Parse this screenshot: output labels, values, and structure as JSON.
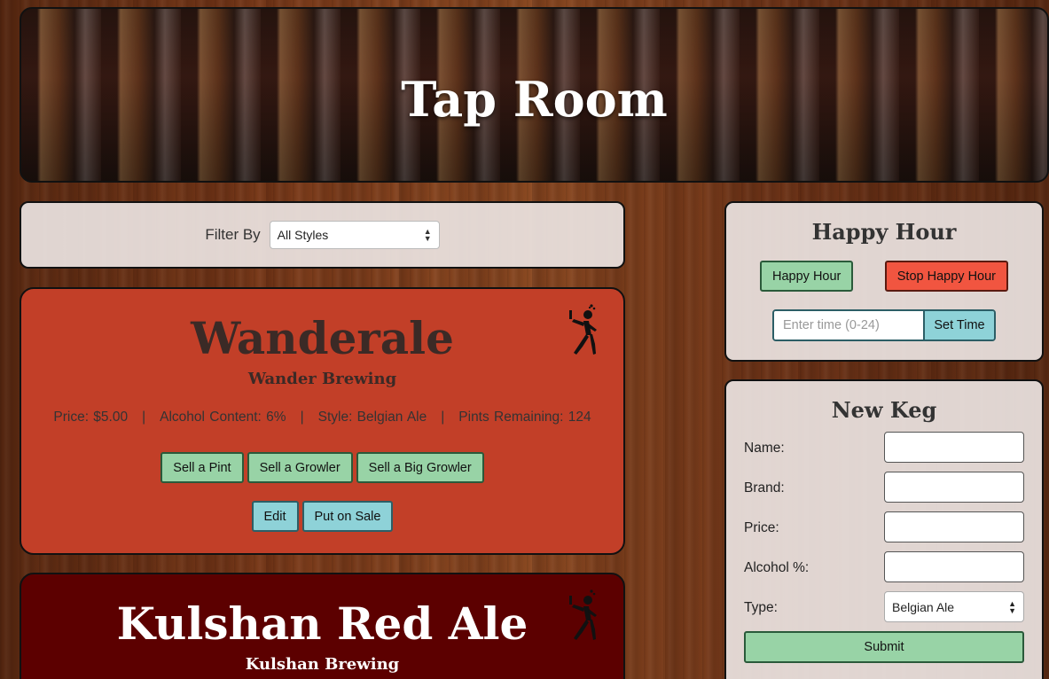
{
  "header": {
    "title": "Tap Room"
  },
  "filter": {
    "label": "Filter By",
    "selected": "All Styles"
  },
  "kegs": [
    {
      "name": "Wanderale",
      "brand": "Wander Brewing",
      "price": "Price: $5.00",
      "alcohol": "Alcohol Content: 6%",
      "style": "Style: Belgian Ale",
      "pints": "Pints Remaining: 124",
      "sep": "|",
      "color": "#c23f28",
      "icon": "drunk-person-icon",
      "buttons": {
        "sell_pint": "Sell a Pint",
        "sell_growler": "Sell a Growler",
        "sell_big_growler": "Sell a Big Growler",
        "edit": "Edit",
        "sale": "Put on Sale"
      }
    },
    {
      "name": "Kulshan Red Ale",
      "brand": "Kulshan Brewing",
      "color": "#5c0000",
      "icon": "drunk-person-icon"
    }
  ],
  "happy_hour": {
    "title": "Happy Hour",
    "start_label": "Happy Hour",
    "stop_label": "Stop Happy Hour",
    "time_placeholder": "Enter time (0-24)",
    "set_time_label": "Set Time"
  },
  "new_keg": {
    "title": "New Keg",
    "name_label": "Name:",
    "brand_label": "Brand:",
    "price_label": "Price:",
    "alcohol_label": "Alcohol %:",
    "type_label": "Type:",
    "type_selected": "Belgian Ale",
    "submit_label": "Submit"
  },
  "colors": {
    "green_button": "#98d3a6",
    "blue_button": "#8ed2d8",
    "red_button": "#f15540"
  }
}
